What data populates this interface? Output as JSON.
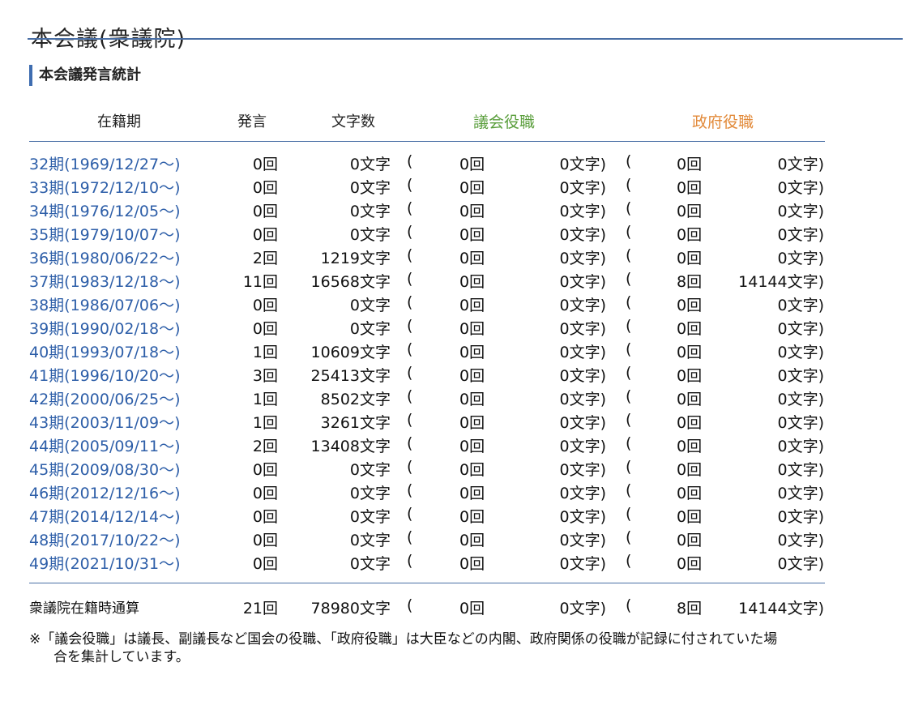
{
  "page": {
    "title": "本会議(衆議院)"
  },
  "section": {
    "heading": "本会議発言統計"
  },
  "table": {
    "headers": {
      "term": "在籍期",
      "speeches": "発言",
      "chars": "文字数",
      "diet_role": "議会役職",
      "gov_role": "政府役職"
    },
    "open_paren": "(",
    "rows": [
      {
        "term": "32期(1969/12/27〜)",
        "speeches": "0回",
        "chars": "0文字",
        "diet_count": "0回",
        "diet_chars": "0文字)",
        "gov_count": "0回",
        "gov_chars": "0文字)"
      },
      {
        "term": "33期(1972/12/10〜)",
        "speeches": "0回",
        "chars": "0文字",
        "diet_count": "0回",
        "diet_chars": "0文字)",
        "gov_count": "0回",
        "gov_chars": "0文字)"
      },
      {
        "term": "34期(1976/12/05〜)",
        "speeches": "0回",
        "chars": "0文字",
        "diet_count": "0回",
        "diet_chars": "0文字)",
        "gov_count": "0回",
        "gov_chars": "0文字)"
      },
      {
        "term": "35期(1979/10/07〜)",
        "speeches": "0回",
        "chars": "0文字",
        "diet_count": "0回",
        "diet_chars": "0文字)",
        "gov_count": "0回",
        "gov_chars": "0文字)"
      },
      {
        "term": "36期(1980/06/22〜)",
        "speeches": "2回",
        "chars": "1219文字",
        "diet_count": "0回",
        "diet_chars": "0文字)",
        "gov_count": "0回",
        "gov_chars": "0文字)"
      },
      {
        "term": "37期(1983/12/18〜)",
        "speeches": "11回",
        "chars": "16568文字",
        "diet_count": "0回",
        "diet_chars": "0文字)",
        "gov_count": "8回",
        "gov_chars": "14144文字)"
      },
      {
        "term": "38期(1986/07/06〜)",
        "speeches": "0回",
        "chars": "0文字",
        "diet_count": "0回",
        "diet_chars": "0文字)",
        "gov_count": "0回",
        "gov_chars": "0文字)"
      },
      {
        "term": "39期(1990/02/18〜)",
        "speeches": "0回",
        "chars": "0文字",
        "diet_count": "0回",
        "diet_chars": "0文字)",
        "gov_count": "0回",
        "gov_chars": "0文字)"
      },
      {
        "term": "40期(1993/07/18〜)",
        "speeches": "1回",
        "chars": "10609文字",
        "diet_count": "0回",
        "diet_chars": "0文字)",
        "gov_count": "0回",
        "gov_chars": "0文字)"
      },
      {
        "term": "41期(1996/10/20〜)",
        "speeches": "3回",
        "chars": "25413文字",
        "diet_count": "0回",
        "diet_chars": "0文字)",
        "gov_count": "0回",
        "gov_chars": "0文字)"
      },
      {
        "term": "42期(2000/06/25〜)",
        "speeches": "1回",
        "chars": "8502文字",
        "diet_count": "0回",
        "diet_chars": "0文字)",
        "gov_count": "0回",
        "gov_chars": "0文字)"
      },
      {
        "term": "43期(2003/11/09〜)",
        "speeches": "1回",
        "chars": "3261文字",
        "diet_count": "0回",
        "diet_chars": "0文字)",
        "gov_count": "0回",
        "gov_chars": "0文字)"
      },
      {
        "term": "44期(2005/09/11〜)",
        "speeches": "2回",
        "chars": "13408文字",
        "diet_count": "0回",
        "diet_chars": "0文字)",
        "gov_count": "0回",
        "gov_chars": "0文字)"
      },
      {
        "term": "45期(2009/08/30〜)",
        "speeches": "0回",
        "chars": "0文字",
        "diet_count": "0回",
        "diet_chars": "0文字)",
        "gov_count": "0回",
        "gov_chars": "0文字)"
      },
      {
        "term": "46期(2012/12/16〜)",
        "speeches": "0回",
        "chars": "0文字",
        "diet_count": "0回",
        "diet_chars": "0文字)",
        "gov_count": "0回",
        "gov_chars": "0文字)"
      },
      {
        "term": "47期(2014/12/14〜)",
        "speeches": "0回",
        "chars": "0文字",
        "diet_count": "0回",
        "diet_chars": "0文字)",
        "gov_count": "0回",
        "gov_chars": "0文字)"
      },
      {
        "term": "48期(2017/10/22〜)",
        "speeches": "0回",
        "chars": "0文字",
        "diet_count": "0回",
        "diet_chars": "0文字)",
        "gov_count": "0回",
        "gov_chars": "0文字)"
      },
      {
        "term": "49期(2021/10/31〜)",
        "speeches": "0回",
        "chars": "0文字",
        "diet_count": "0回",
        "diet_chars": "0文字)",
        "gov_count": "0回",
        "gov_chars": "0文字)"
      }
    ],
    "total": {
      "label": "衆議院在籍時通算",
      "speeches": "21回",
      "chars": "78980文字",
      "diet_count": "0回",
      "diet_chars": "0文字)",
      "gov_count": "8回",
      "gov_chars": "14144文字)"
    }
  },
  "note": {
    "line1": "※「議会役職」は議長、副議長など国会の役職、「政府役職」は大臣などの内閣、政府関係の役職が記録に付されていた場",
    "line2": "合を集計しています。"
  },
  "colors": {
    "link": "#2d5ea8",
    "rule": "#4a6fa5",
    "diet_role_header": "#5a9e3c",
    "gov_role_header": "#e28a3a"
  }
}
